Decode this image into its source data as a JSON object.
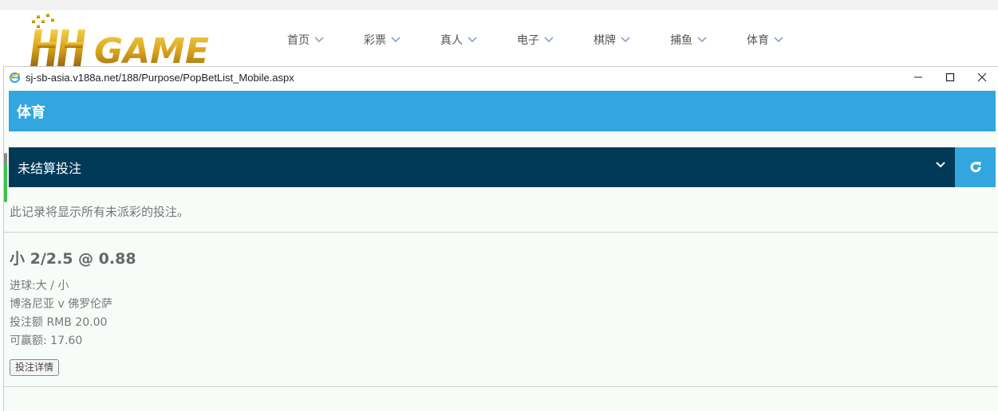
{
  "site": {
    "logo_text": "HH GAME",
    "nav": [
      {
        "label": "首页"
      },
      {
        "label": "彩票"
      },
      {
        "label": "真人"
      },
      {
        "label": "电子"
      },
      {
        "label": "棋牌"
      },
      {
        "label": "捕鱼"
      },
      {
        "label": "体育"
      }
    ]
  },
  "popup": {
    "url": "sj-sb-asia.v188a.net/188/Purpose/PopBetList_Mobile.aspx",
    "header_title": "体育",
    "filter_selected": "未结算投注",
    "info": "此记录将显示所有未派彩的投注。",
    "bet": {
      "title": "小 2/2.5 @ 0.88",
      "market": "进球:大 / 小",
      "match": "博洛尼亚 v 佛罗伦萨",
      "stake": "投注额 RMB 20.00",
      "payout": "可赢额: 17.60",
      "details_button": "投注详情"
    }
  },
  "icons": {
    "nav_chevron": "chevron-down-icon",
    "browser": "ie-icon",
    "minimize": "minimize-icon",
    "maximize": "maximize-icon",
    "close": "close-icon",
    "refresh": "refresh-icon"
  },
  "colors": {
    "header_blue": "#33a6df",
    "select_navy": "#003a57",
    "logo_gold": "#d9a21b"
  }
}
